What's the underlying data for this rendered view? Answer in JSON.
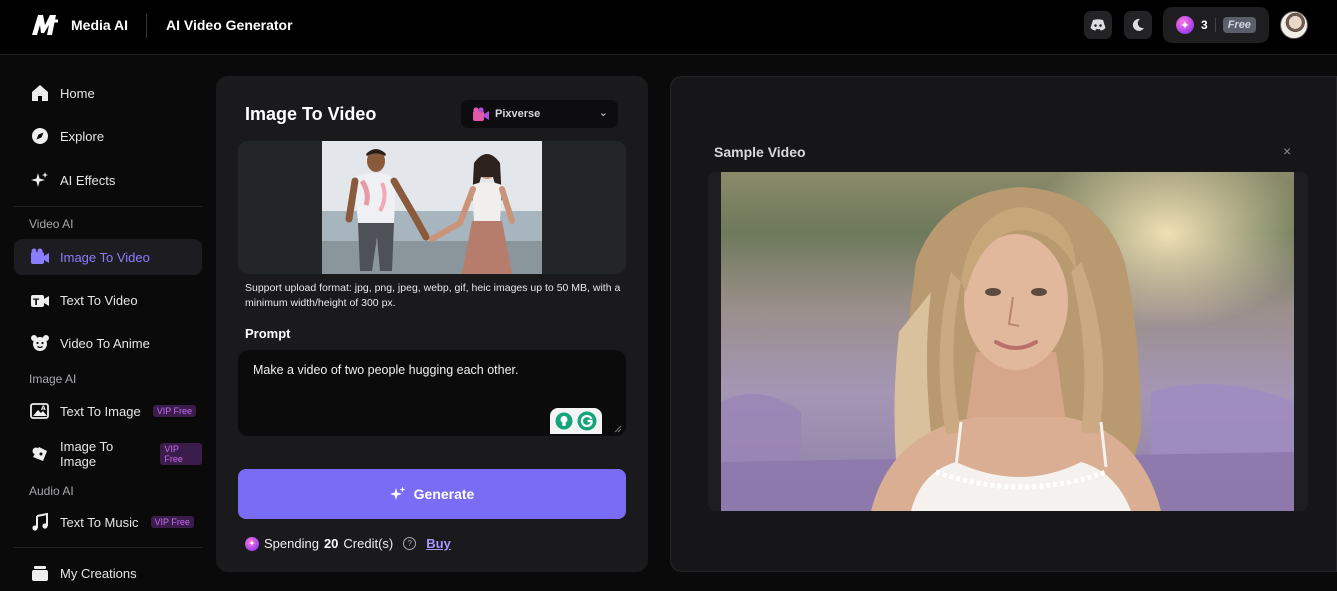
{
  "header": {
    "brand": "Media AI",
    "page_name": "AI Video Generator",
    "credits": "3",
    "plan_badge": "Free"
  },
  "sidebar": {
    "items_top": [
      {
        "label": "Home",
        "icon": "home-icon"
      },
      {
        "label": "Explore",
        "icon": "compass-icon"
      },
      {
        "label": "AI Effects",
        "icon": "sparkles-icon"
      }
    ],
    "section_video": "Video AI",
    "items_video": [
      {
        "label": "Image To Video",
        "icon": "image-video-icon",
        "active": true
      },
      {
        "label": "Text To Video",
        "icon": "text-video-icon"
      },
      {
        "label": "Video To Anime",
        "icon": "anime-face-icon"
      }
    ],
    "section_image": "Image AI",
    "items_image": [
      {
        "label": "Text To Image",
        "icon": "text-image-icon",
        "badge": "VIP Free"
      },
      {
        "label": "Image To Image",
        "icon": "image-image-icon",
        "badge": "VIP Free"
      }
    ],
    "section_audio": "Audio AI",
    "items_audio": [
      {
        "label": "Text To Music",
        "icon": "music-note-icon",
        "badge": "VIP Free"
      }
    ],
    "items_bottom": [
      {
        "label": "My Creations",
        "icon": "creations-icon"
      }
    ]
  },
  "form": {
    "title": "Image To Video",
    "model": "Pixverse",
    "support_text": "Support upload format: jpg, png, jpeg, webp, gif, heic images up to 50 MB, with a minimum width/height of 300 px.",
    "prompt_label": "Prompt",
    "prompt_value": "Make a video of two people hugging each other.",
    "generate_label": "Generate",
    "spending_prefix": "Spending",
    "spending_amount": "20",
    "spending_suffix": "Credit(s)",
    "buy_label": "Buy"
  },
  "sample": {
    "title": "Sample Video",
    "close": "×"
  },
  "colors": {
    "accent": "#7b6cf6",
    "active_text": "#8b7dff",
    "vip": "#c86bf0"
  }
}
